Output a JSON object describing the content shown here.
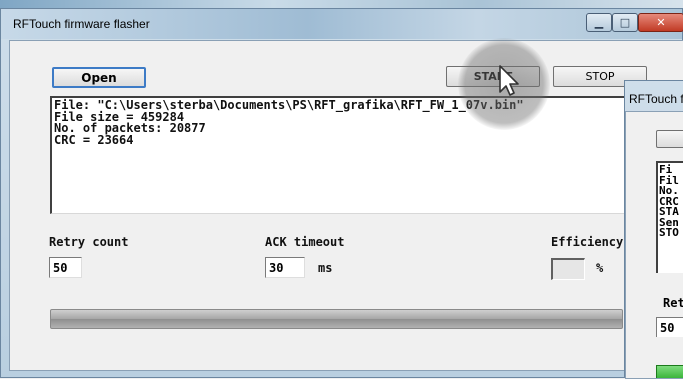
{
  "window": {
    "title": "RFTouch firmware flasher",
    "controls": {
      "minimize_icon": "minimize-icon",
      "maximize_icon": "maximize-icon",
      "close_icon": "close-icon"
    }
  },
  "toolbar": {
    "open_label": "Open",
    "start_label": "START",
    "stop_label": "STOP"
  },
  "log": {
    "lines": [
      "File: \"C:\\Users\\sterba\\Documents\\PS\\RFT_grafika\\RFT_FW_1_07v.bin\"",
      "File size = 459284",
      "No. of packets: 20877",
      "CRC = 23664"
    ]
  },
  "settings": {
    "retry_label": "Retry count",
    "retry_value": "50",
    "ack_label": "ACK timeout",
    "ack_value": "30",
    "ack_unit": "ms",
    "efficiency_label": "Efficiency",
    "efficiency_value": "",
    "efficiency_unit": "%"
  },
  "progress": {
    "fraction": 1.0
  },
  "second_window": {
    "title": "RFTouch fir",
    "log_lines": [
      "Fi",
      "Fil",
      "No.",
      "CRC",
      "STA",
      "Sen",
      "STO"
    ],
    "retry_label": "Ret",
    "retry_value": "50"
  },
  "colors": {
    "accent": "#3d7bc6",
    "close": "#c13b25",
    "progress": "#9a9a9a"
  }
}
